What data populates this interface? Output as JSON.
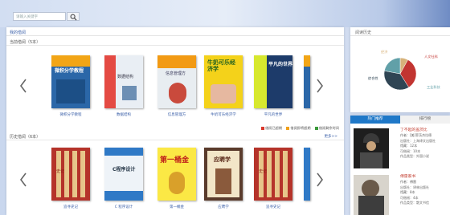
{
  "search": {
    "placeholder": "请输入关键字"
  },
  "main": {
    "title": "我的借阅",
    "current": {
      "title": "当前借阅（5本）",
      "books": [
        {
          "caption": "微积分学教程",
          "cover_title": "微积分学教程",
          "cover_color": "#2b67a8"
        },
        {
          "caption": "数据结构",
          "cover_title": "数据结构",
          "cover_color": "#e9eef4"
        },
        {
          "caption": "信息管理方",
          "cover_title": "信息管理方",
          "cover_color": "#e8edf1"
        },
        {
          "caption": "牛奶可乐经济学",
          "cover_title": "牛奶可乐经济学",
          "cover_color": "#f4d21a"
        },
        {
          "caption": "平凡的世界",
          "cover_title": "平凡的世界",
          "cover_color": "#1d3b6a"
        }
      ]
    },
    "legend": {
      "items": [
        {
          "label": "借阅已超期",
          "color": "#d9382c"
        },
        {
          "label": "借阅即将超期",
          "color": "#f0a01a"
        },
        {
          "label": "借阅剩余时间",
          "color": "#3a9a3a"
        }
      ]
    },
    "history": {
      "title": "历史借阅（6本）",
      "more": "更多>>",
      "books": [
        {
          "caption": "追寻史记",
          "cover_title": "史记",
          "cover_color": "#b5332a"
        },
        {
          "caption": "C 程序设计",
          "cover_title": "C程序设计",
          "cover_color": "#eef3f8"
        },
        {
          "caption": "第一桶金",
          "cover_title": "第一桶金",
          "cover_color": "#fbe845"
        },
        {
          "caption": "应聘学",
          "cover_title": "应聘学",
          "cover_color": "#5a3b2c"
        },
        {
          "caption": "追寻史记",
          "cover_title": "史记",
          "cover_color": "#b5332a"
        }
      ]
    }
  },
  "side": {
    "analysis_title": "阅读历史",
    "pie_labels": [
      "经济",
      "人文社科",
      "综合性",
      "工业科技"
    ],
    "chart_data": {
      "type": "pie",
      "labels": [
        "经济",
        "人文社科",
        "综合性",
        "工业科技"
      ],
      "values": [
        8,
        33,
        37,
        22
      ],
      "colors": [
        "#d7b27a",
        "#c23531",
        "#2f4554",
        "#61a0a8"
      ]
    },
    "tabs": {
      "active": "热门推荐",
      "inactive": "排行榜"
    },
    "recommendations": [
      {
        "name": "了不起的盖茨比",
        "lines": [
          "作者：[美]菲茨杰拉德",
          "出版社：上海译文出版社",
          "馆藏：12本",
          "可借阅：10本",
          "作品类型：外国小说"
        ]
      },
      {
        "name": "傅雷家书",
        "lines": [
          "作者：傅雷",
          "出版社：译林出版社",
          "馆藏：8本",
          "可借阅：4本",
          "作品类型：散文书信"
        ]
      }
    ]
  }
}
